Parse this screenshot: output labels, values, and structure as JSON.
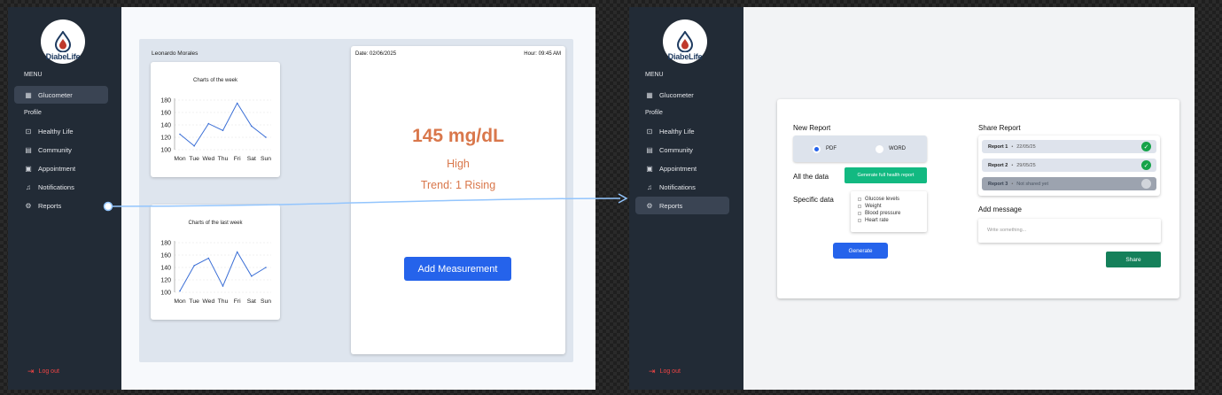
{
  "app": {
    "logo_text": "DiabeLife",
    "logo_accent": "Life"
  },
  "sidebar": {
    "menu_label": "MENU",
    "profile_label": "Profile",
    "items": [
      {
        "id": "glucometer",
        "label": "Glucometer",
        "icon": "dashboard-icon"
      },
      {
        "id": "healthy-life",
        "label": "Healthy Life",
        "icon": "scan-icon"
      },
      {
        "id": "community",
        "label": "Community",
        "icon": "chat-icon"
      },
      {
        "id": "appointment",
        "label": "Appointment",
        "icon": "calendar-icon"
      },
      {
        "id": "notifications",
        "label": "Notifications",
        "icon": "bell-icon"
      },
      {
        "id": "reports",
        "label": "Reports",
        "icon": "gear-icon"
      }
    ],
    "logout_label": "Log out"
  },
  "dashboard": {
    "user_name": "Leonardo Morales",
    "date": "Date: 02/06/2025",
    "hour": "Hour: 09:45 AM",
    "reading": "145 mg/dL",
    "status": "High",
    "trend": "Trend: 1 Rising",
    "add_button": "Add Measurement",
    "chart_data": [
      {
        "type": "line",
        "title": "Charts of the week",
        "categories": [
          "Mon",
          "Tue",
          "Wed",
          "Thu",
          "Fri",
          "Sat",
          "Sun"
        ],
        "values": [
          125,
          106,
          142,
          131,
          175,
          138,
          120
        ],
        "yticks": [
          100,
          120,
          140,
          160,
          180
        ],
        "ylim": [
          100,
          180
        ],
        "grid": true,
        "color": "#3b6fd6"
      },
      {
        "type": "line",
        "title": "Charts of the last week",
        "categories": [
          "Mon",
          "Tue",
          "Wed",
          "Thu",
          "Fri",
          "Sat",
          "Sun"
        ],
        "values": [
          102,
          143,
          155,
          110,
          165,
          126,
          140
        ],
        "yticks": [
          100,
          120,
          140,
          160,
          180
        ],
        "ylim": [
          100,
          180
        ],
        "grid": true,
        "color": "#3b6fd6"
      }
    ]
  },
  "reports": {
    "new_report_title": "New Report",
    "format_options": [
      {
        "label": "PDF",
        "selected": true
      },
      {
        "label": "WORD",
        "selected": false
      }
    ],
    "all_data_label": "All the data",
    "generate_full_button": "Generate full health report",
    "specific_data_label": "Specific data",
    "specific_options": [
      "Glucose levels",
      "Weight",
      "Blood pressure",
      "Heart rate"
    ],
    "generate_button": "Generate",
    "share_title": "Share Report",
    "shared_reports": [
      {
        "name": "Report 1",
        "separator": "•",
        "status": "22/05/25",
        "shared": true
      },
      {
        "name": "Report 2",
        "separator": "•",
        "status": "29/05/25",
        "shared": true
      },
      {
        "name": "Report 3",
        "separator": "•",
        "status": "Not shared yet",
        "shared": false
      }
    ],
    "add_message_label": "Add  message",
    "message_placeholder": "Write something...",
    "share_button": "Share"
  },
  "colors": {
    "sidebar_bg": "#222b36",
    "accent_blue": "#2563eb",
    "reading_orange": "#d9774b",
    "success_green": "#12b981",
    "share_green": "#15805a",
    "logout_red": "#ef4444",
    "connector": "#93c5fd"
  }
}
